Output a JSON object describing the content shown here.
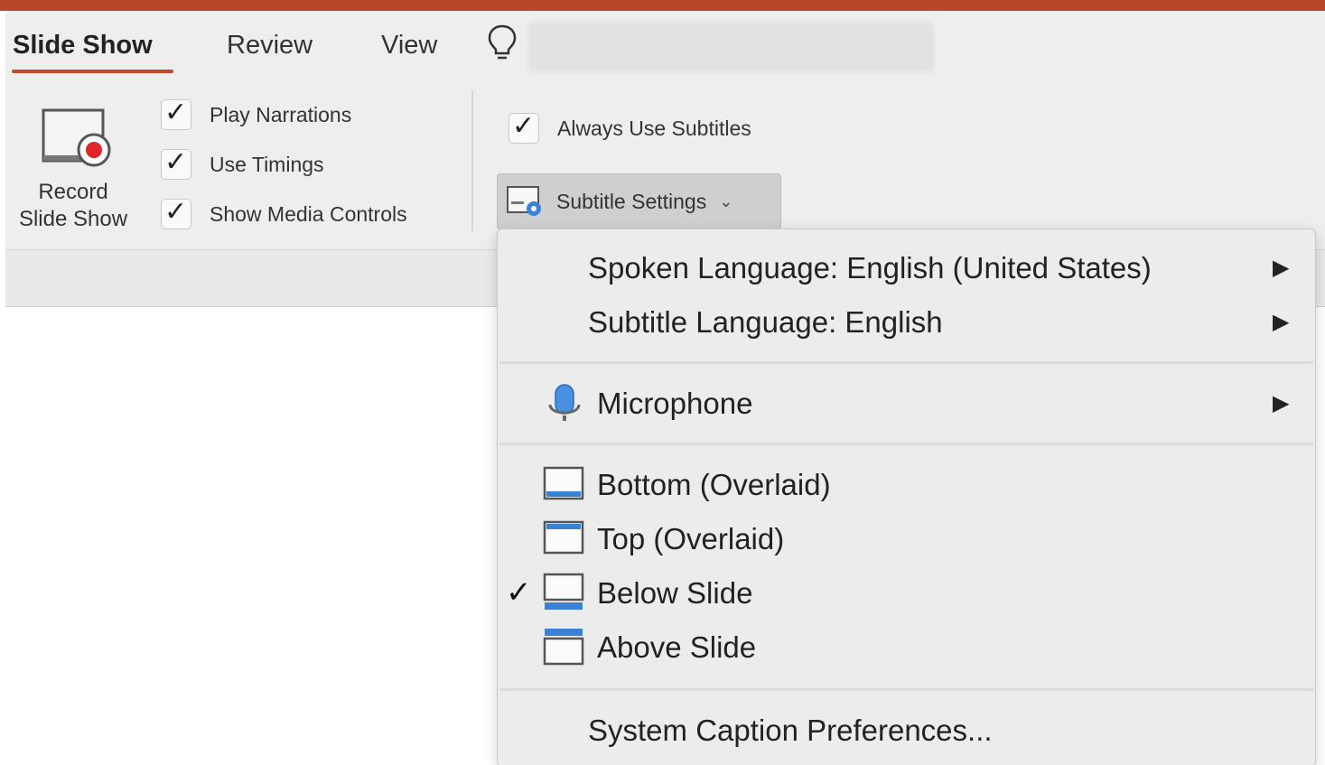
{
  "colors": {
    "accent": "#b7472a",
    "ribbon_bg": "#eeeeee",
    "menu_bg": "#ececec",
    "icon_blue": "#3b82d6",
    "record_red": "#e0262a"
  },
  "tabs": [
    {
      "label": "Slide Show",
      "active": true
    },
    {
      "label": "Review",
      "active": false
    },
    {
      "label": "View",
      "active": false
    }
  ],
  "ribbon": {
    "record": {
      "line1": "Record",
      "line2": "Slide Show",
      "icon": "record-slide-show-icon"
    },
    "checkboxes": [
      {
        "label": "Play Narrations",
        "checked": true
      },
      {
        "label": "Use Timings",
        "checked": true
      },
      {
        "label": "Show Media Controls",
        "checked": true
      }
    ],
    "always_subtitles": {
      "label": "Always Use Subtitles",
      "checked": true
    },
    "subtitle_settings": {
      "label": "Subtitle Settings",
      "icon": "subtitle-settings-icon"
    }
  },
  "menu": {
    "spoken_language": "Spoken Language: English (United States)",
    "subtitle_language": "Subtitle Language: English",
    "microphone": "Microphone",
    "positions": [
      {
        "label": "Bottom (Overlaid)",
        "icon": "bottom-overlaid-icon",
        "checked": false
      },
      {
        "label": "Top (Overlaid)",
        "icon": "top-overlaid-icon",
        "checked": false
      },
      {
        "label": "Below Slide",
        "icon": "below-slide-icon",
        "checked": true
      },
      {
        "label": "Above Slide",
        "icon": "above-slide-icon",
        "checked": false
      }
    ],
    "system_caption": "System Caption Preferences...",
    "submenu_arrow": "▶",
    "check_glyph": "✓"
  }
}
